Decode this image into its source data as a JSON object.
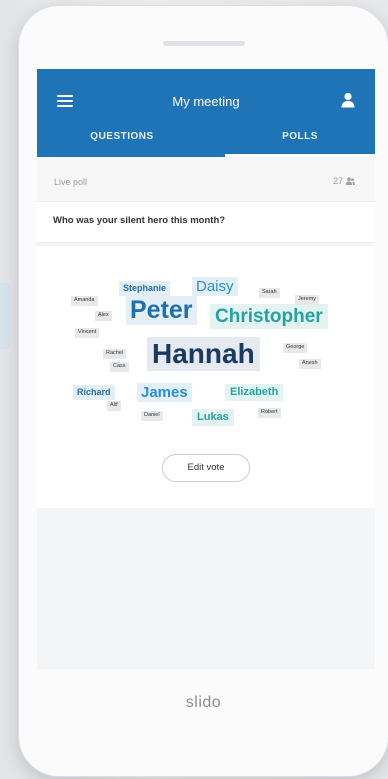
{
  "header": {
    "title": "My meeting",
    "tabs": [
      {
        "label": "QUESTIONS",
        "active": false
      },
      {
        "label": "POLLS",
        "active": true
      }
    ]
  },
  "poll": {
    "status_label": "Live poll",
    "participant_count": "27",
    "question": "Who was your silent hero this month?",
    "edit_button_label": "Edit vote"
  },
  "word_cloud": [
    {
      "text": "Stephanie",
      "style": "mid"
    },
    {
      "text": "Daisy",
      "style": "blue"
    },
    {
      "text": "Amanda",
      "style": "small"
    },
    {
      "text": "Alex",
      "style": "small"
    },
    {
      "text": "Peter",
      "style": "big-blue"
    },
    {
      "text": "Christopher",
      "style": "big-teal"
    },
    {
      "text": "Sarah",
      "style": "small"
    },
    {
      "text": "Jeremy",
      "style": "small"
    },
    {
      "text": "Vincent",
      "style": "small"
    },
    {
      "text": "Rachel",
      "style": "small"
    },
    {
      "text": "Hannah",
      "style": "huge"
    },
    {
      "text": "George",
      "style": "small"
    },
    {
      "text": "Cass",
      "style": "small"
    },
    {
      "text": "Anesh",
      "style": "small"
    },
    {
      "text": "Richard",
      "style": "mid"
    },
    {
      "text": "James",
      "style": "blue"
    },
    {
      "text": "Elizabeth",
      "style": "teal"
    },
    {
      "text": "Alif",
      "style": "small"
    },
    {
      "text": "Daniel",
      "style": "small"
    },
    {
      "text": "Lukas",
      "style": "teal"
    },
    {
      "text": "Robert",
      "style": "small"
    }
  ],
  "footer": {
    "brand": "slido"
  },
  "colors": {
    "header": "#1f73b7",
    "hannah": "#1b3a63",
    "peter": "#1e6fae",
    "christopher": "#26a3a0"
  }
}
